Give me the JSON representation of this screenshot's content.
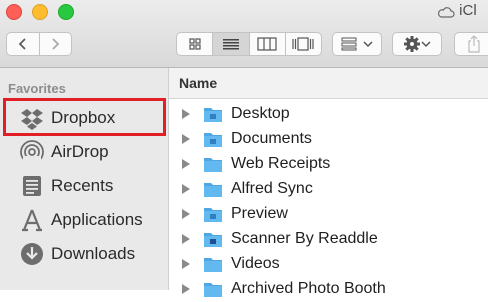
{
  "window": {
    "title": "iCl",
    "icons": {
      "title": "cloud-icon"
    }
  },
  "toolbar": {
    "back": "chevron-left-icon",
    "forward": "chevron-right-icon",
    "views": [
      "icon-view-icon",
      "list-view-icon",
      "column-view-icon",
      "cover-flow-icon"
    ],
    "active_view": "list",
    "arrange": "arrange-icon",
    "action": "gear-icon",
    "share": "share-icon"
  },
  "sidebar": {
    "header": "Favorites",
    "items": [
      {
        "label": "Dropbox",
        "icon": "dropbox-icon",
        "highlighted": true
      },
      {
        "label": "AirDrop",
        "icon": "airdrop-icon"
      },
      {
        "label": "Recents",
        "icon": "recents-icon"
      },
      {
        "label": "Applications",
        "icon": "applications-icon"
      },
      {
        "label": "Downloads",
        "icon": "downloads-icon"
      }
    ]
  },
  "list": {
    "header": "Name",
    "rows": [
      {
        "name": "Desktop",
        "icon": "folder-desktop-icon"
      },
      {
        "name": "Documents",
        "icon": "folder-documents-icon"
      },
      {
        "name": "Web Receipts",
        "icon": "folder-icon"
      },
      {
        "name": "Alfred Sync",
        "icon": "folder-icon"
      },
      {
        "name": "Preview",
        "icon": "folder-preview-icon"
      },
      {
        "name": "Scanner By Readdle",
        "icon": "folder-scanner-icon"
      },
      {
        "name": "Videos",
        "icon": "folder-icon"
      },
      {
        "name": "Archived Photo Booth",
        "icon": "folder-icon"
      }
    ]
  },
  "colors": {
    "highlight": "#e21f26",
    "folder": "#62b9f0",
    "sidebar_bg": "#e9e9e9"
  }
}
